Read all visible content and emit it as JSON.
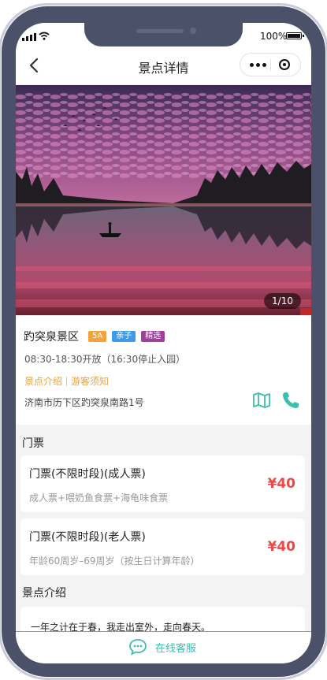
{
  "status_bar": {
    "battery_label": "100%"
  },
  "nav": {
    "title": "景点详情"
  },
  "gallery": {
    "counter": "1/10"
  },
  "scenic": {
    "name": "趵突泉景区",
    "tags": [
      {
        "label": "5A",
        "color": "#f5a33b"
      },
      {
        "label": "亲子",
        "color": "#3d9be9"
      },
      {
        "label": "精选",
        "color": "#a0409c"
      }
    ],
    "hours": "08:30-18:30开放（16:30停止入园）",
    "links": [
      "景点介绍",
      "游客须知"
    ],
    "address": "济南市历下区趵突泉南路1号"
  },
  "tickets": {
    "section_title": "门票",
    "items": [
      {
        "name": "门票(不限时段)(成人票)",
        "desc": "成人票+喂奶鱼食票+海龟味食票",
        "price": "¥40"
      },
      {
        "name": "门票(不限时段)(老人票)",
        "desc": "年龄60周岁–69周岁（按生日计算年龄）",
        "price": "¥40"
      }
    ]
  },
  "intro": {
    "section_title": "景点介绍",
    "text": "一年之计在于春，我走出室外，走向春天。"
  },
  "footer": {
    "service_label": "在线客服"
  },
  "colors": {
    "accent": "#3cbfae",
    "price": "#e84a4a",
    "link": "#f0a33a"
  }
}
